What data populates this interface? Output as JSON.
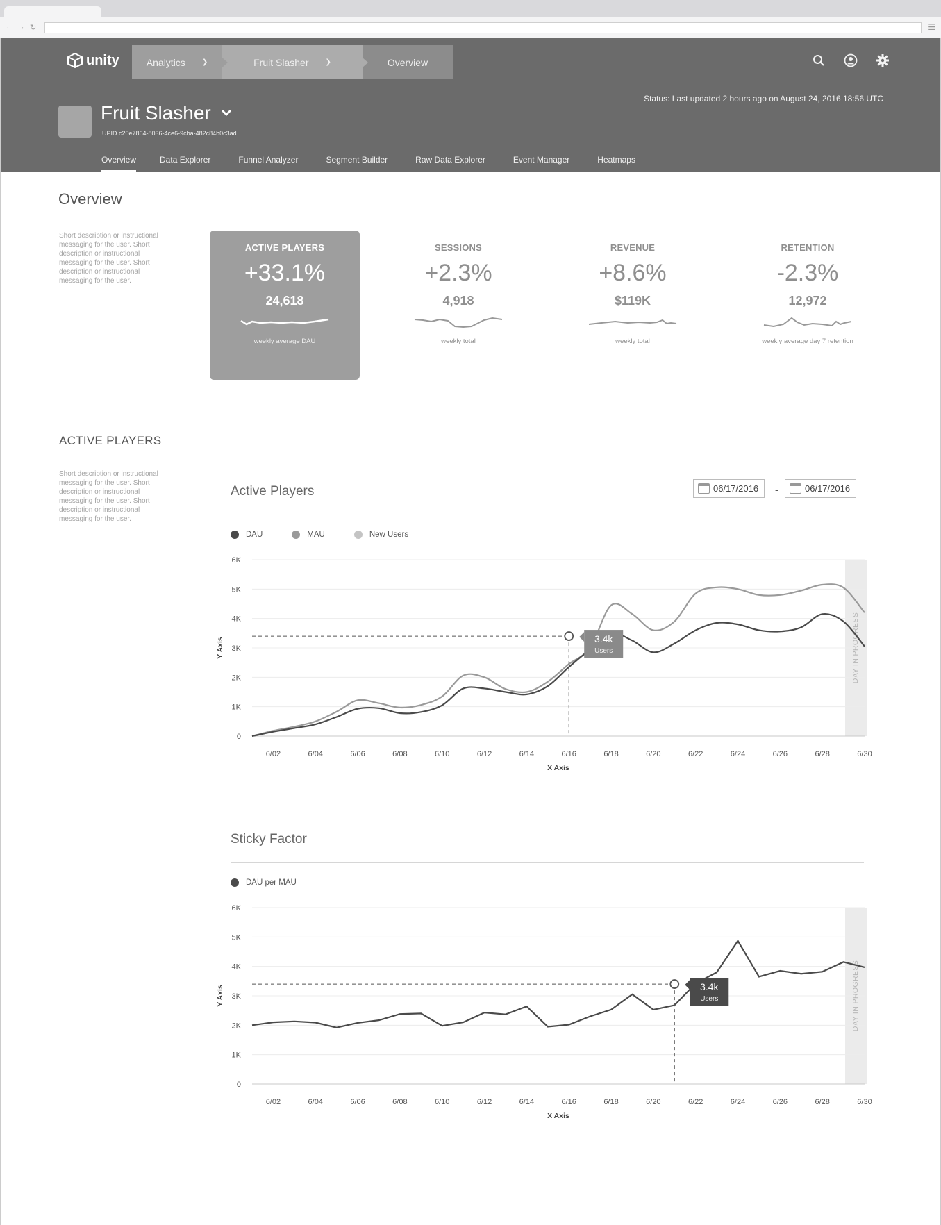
{
  "browser": {
    "nav_icons": [
      "back-arrow-icon",
      "forward-arrow-icon",
      "reload-icon"
    ],
    "menu_icon": "hamburger-icon"
  },
  "header": {
    "logo_text": "unity",
    "breadcrumbs": [
      {
        "label": "Analytics",
        "has_dropdown": true
      },
      {
        "label": "Fruit Slasher",
        "has_dropdown": true
      },
      {
        "label": "Overview",
        "has_dropdown": false
      }
    ],
    "icons": [
      "search-icon",
      "user-icon",
      "gear-icon"
    ],
    "status": "Status: Last updated 2 hours ago on August 24, 2016 18:56 UTC",
    "app_name": "Fruit Slasher",
    "upid": "UPID c20e7864-8036-4ce6-9cba-482c84b0c3ad",
    "tabs": [
      "Overview",
      "Data Explorer",
      "Funnel Analyzer",
      "Segment Builder",
      "Raw Data Explorer",
      "Event Manager",
      "Heatmaps"
    ],
    "active_tab": "Overview",
    "background_color": "#6b6b6b"
  },
  "overview": {
    "title": "Overview",
    "description": "Short description or instructional messaging for the user. Short description or instructional messaging for the user. Short description or instructional messaging for the user."
  },
  "kpis": [
    {
      "title": "ACTIVE PLAYERS",
      "change": "+33.1%",
      "value": "24,618",
      "note": "weekly average DAU",
      "active": true
    },
    {
      "title": "SESSIONS",
      "change": "+2.3%",
      "value": "4,918",
      "note": "weekly total",
      "active": false
    },
    {
      "title": "REVENUE",
      "change": "+8.6%",
      "value": "$119K",
      "note": "weekly total",
      "active": false
    },
    {
      "title": "RETENTION",
      "change": "-2.3%",
      "value": "12,972",
      "note": "weekly average day 7 retention",
      "active": false
    }
  ],
  "active_players_section": {
    "title": "ACTIVE PLAYERS",
    "description": "Short description or instructional messaging for the user. Short description or instructional messaging for the user. Short description or instructional messaging for the user."
  },
  "date_range": {
    "start": "06/17/2016",
    "end": "06/17/2016",
    "separator": "-"
  },
  "chart_data": [
    {
      "type": "line",
      "title": "Active Players",
      "xlabel": "X Axis",
      "ylabel": "Y Axis",
      "x_ticks": [
        "6/02",
        "6/04",
        "6/06",
        "6/08",
        "6/10",
        "6/12",
        "6/14",
        "6/16",
        "6/18",
        "6/20",
        "6/22",
        "6/24",
        "6/26",
        "6/28",
        "6/30"
      ],
      "y_ticks": [
        "0",
        "1K",
        "2K",
        "3K",
        "4K",
        "5K",
        "6K"
      ],
      "ylim": [
        0,
        6000
      ],
      "legend": [
        "DAU",
        "MAU",
        "New Users"
      ],
      "legend_colors": [
        "#4a4a4a",
        "#9a9a9a",
        "#c4c4c4"
      ],
      "x": [
        1,
        2,
        3,
        4,
        5,
        6,
        7,
        8,
        9,
        10,
        11,
        12,
        13,
        14,
        15,
        16,
        17,
        18,
        19,
        20,
        21,
        22,
        23,
        24,
        25,
        26,
        27,
        28,
        29,
        30
      ],
      "series": [
        {
          "name": "DAU",
          "color": "#4a4a4a",
          "values": [
            0,
            150,
            270,
            400,
            650,
            930,
            950,
            780,
            820,
            1050,
            1620,
            1620,
            1500,
            1420,
            1700,
            2350,
            2950,
            3500,
            3250,
            2850,
            3150,
            3600,
            3850,
            3800,
            3600,
            3560,
            3700,
            4150,
            3900,
            3050
          ]
        },
        {
          "name": "MAU",
          "color": "#9a9a9a",
          "values": [
            0,
            180,
            320,
            500,
            830,
            1220,
            1120,
            970,
            1060,
            1350,
            2060,
            2000,
            1600,
            1500,
            1850,
            2450,
            3000,
            4450,
            4150,
            3600,
            3900,
            4850,
            5060,
            5000,
            4800,
            4800,
            4950,
            5150,
            5050,
            4200
          ]
        }
      ],
      "unit_note": "",
      "shaded_region_label": "DAY IN PROGRESS",
      "tooltip": {
        "value": "3.4k",
        "label": "Users",
        "x": "6/16",
        "y": 3400
      }
    },
    {
      "type": "line",
      "title": "Sticky Factor",
      "xlabel": "X Axis",
      "ylabel": "Y Axis",
      "x_ticks": [
        "6/02",
        "6/04",
        "6/06",
        "6/08",
        "6/10",
        "6/12",
        "6/14",
        "6/16",
        "6/18",
        "6/20",
        "6/22",
        "6/24",
        "6/26",
        "6/28",
        "6/30"
      ],
      "y_ticks": [
        "0",
        "1K",
        "2K",
        "3K",
        "4K",
        "5K",
        "6K"
      ],
      "ylim": [
        0,
        6000
      ],
      "legend": [
        "DAU per MAU"
      ],
      "legend_colors": [
        "#4a4a4a"
      ],
      "x": [
        1,
        2,
        3,
        4,
        5,
        6,
        7,
        8,
        9,
        10,
        11,
        12,
        13,
        14,
        15,
        16,
        17,
        18,
        19,
        20,
        21,
        22,
        23,
        24,
        25,
        26,
        27,
        28,
        29,
        30
      ],
      "series": [
        {
          "name": "DAU per MAU",
          "color": "#4a4a4a",
          "values": [
            2000,
            2100,
            2130,
            2090,
            1920,
            2080,
            2170,
            2380,
            2400,
            1980,
            2100,
            2430,
            2370,
            2640,
            1950,
            2020,
            2300,
            2530,
            3050,
            2530,
            2680,
            3420,
            3800,
            4870,
            3650,
            3850,
            3750,
            3820,
            4150,
            3970
          ]
        }
      ],
      "shaded_region_label": "DAY IN PROGRESS",
      "tooltip": {
        "value": "3.4k",
        "label": "Users",
        "x": "6/21",
        "y": 3400
      }
    }
  ]
}
